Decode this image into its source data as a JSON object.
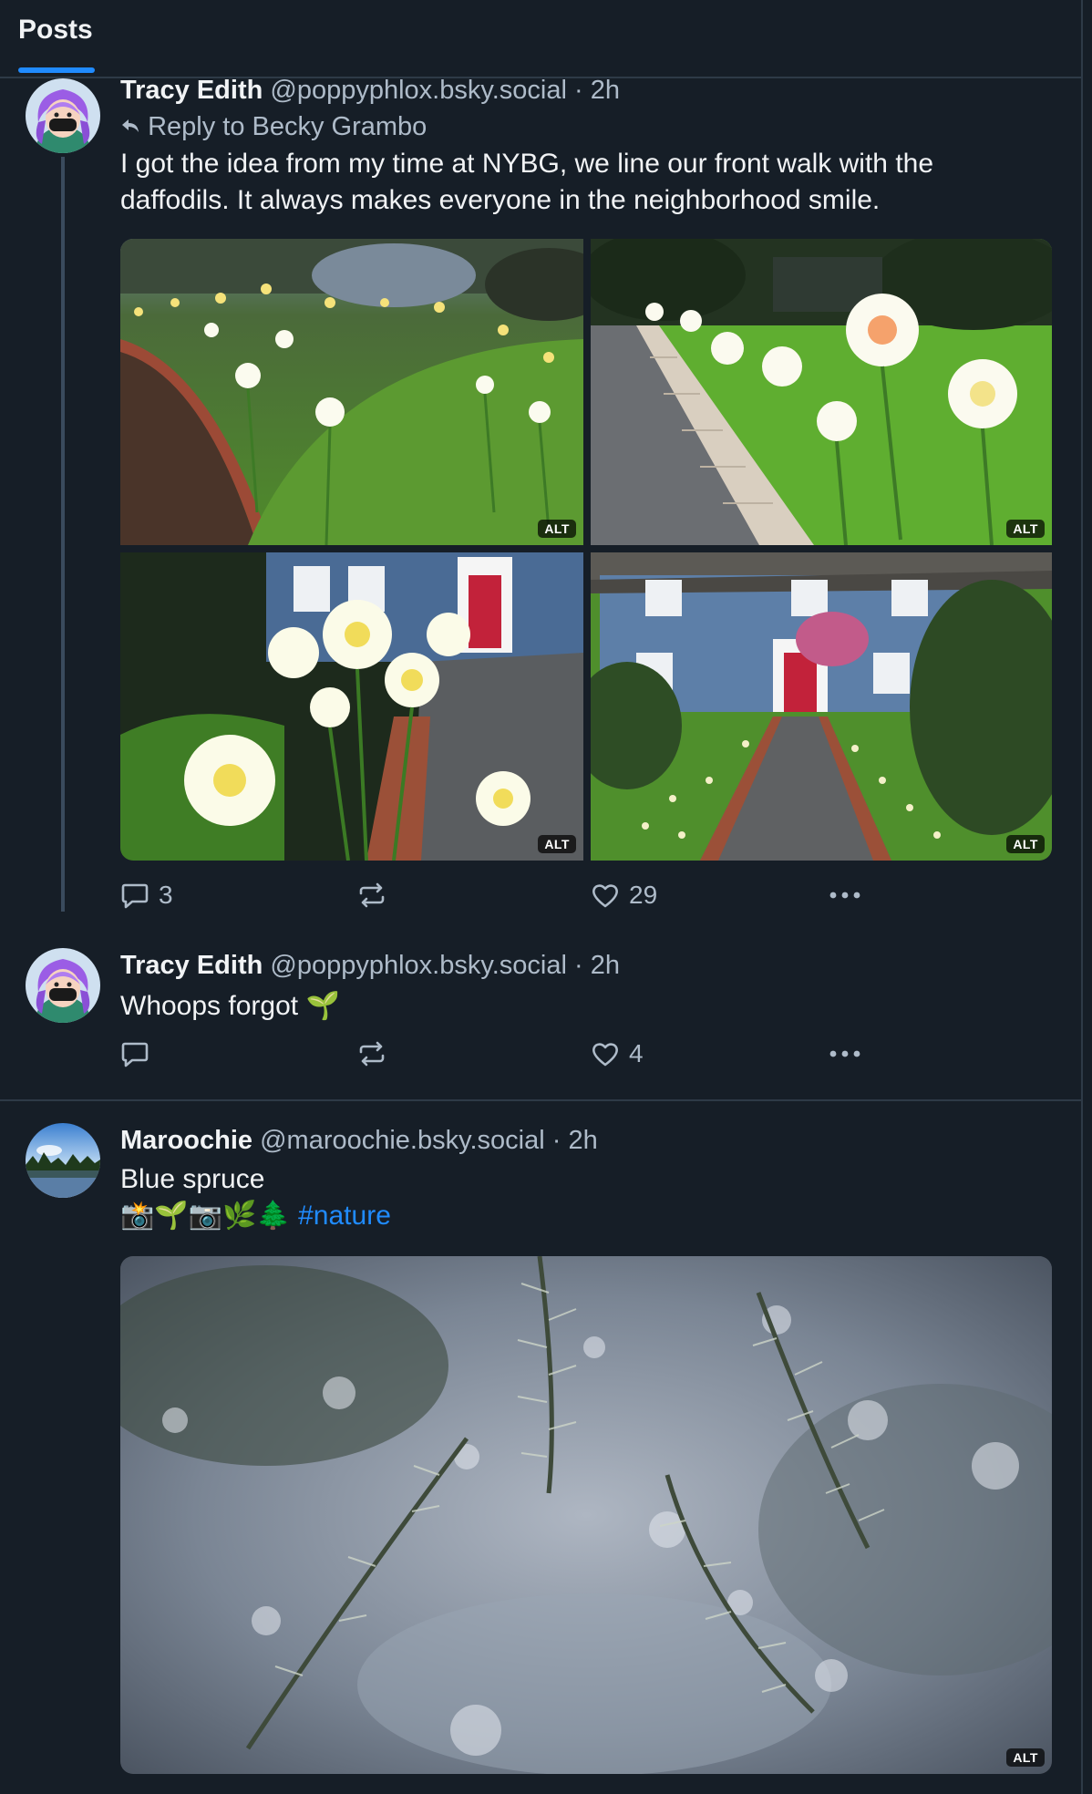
{
  "header": {
    "tab": "Posts"
  },
  "posts": [
    {
      "name": "Tracy Edith",
      "handle": "@poppyphlox.bsky.social",
      "sep": "·",
      "time": "2h",
      "reply_to": "Reply to Becky Grambo",
      "text": "I got the idea from my time at NYBG, we line our front walk with the daffodils. It always makes everyone in the neighborhood smile.",
      "images": [
        {
          "alt": "ALT",
          "icon": "daffodil-garden-bed-photo"
        },
        {
          "alt": "ALT",
          "icon": "daffodil-walkway-photo"
        },
        {
          "alt": "ALT",
          "icon": "daffodils-house-closeup-photo"
        },
        {
          "alt": "ALT",
          "icon": "blue-house-walkway-photo"
        }
      ],
      "replies": "3",
      "reposts": "",
      "likes": "29"
    },
    {
      "name": "Tracy Edith",
      "handle": "@poppyphlox.bsky.social",
      "sep": "·",
      "time": "2h",
      "text": "Whoops forgot 🌱",
      "replies": "",
      "reposts": "",
      "likes": "4"
    },
    {
      "name": "Maroochie",
      "handle": "@maroochie.bsky.social",
      "sep": "·",
      "time": "2h",
      "text": "Blue spruce",
      "tags_prefix": "📸🌱📷🌿🌲",
      "hashtag": "#nature",
      "images": [
        {
          "alt": "ALT",
          "icon": "blue-spruce-photo"
        }
      ]
    }
  ],
  "colors": {
    "background": "#161e27",
    "accent": "#208bfe",
    "muted": "#aebbc9",
    "divider": "#2e3a47"
  }
}
